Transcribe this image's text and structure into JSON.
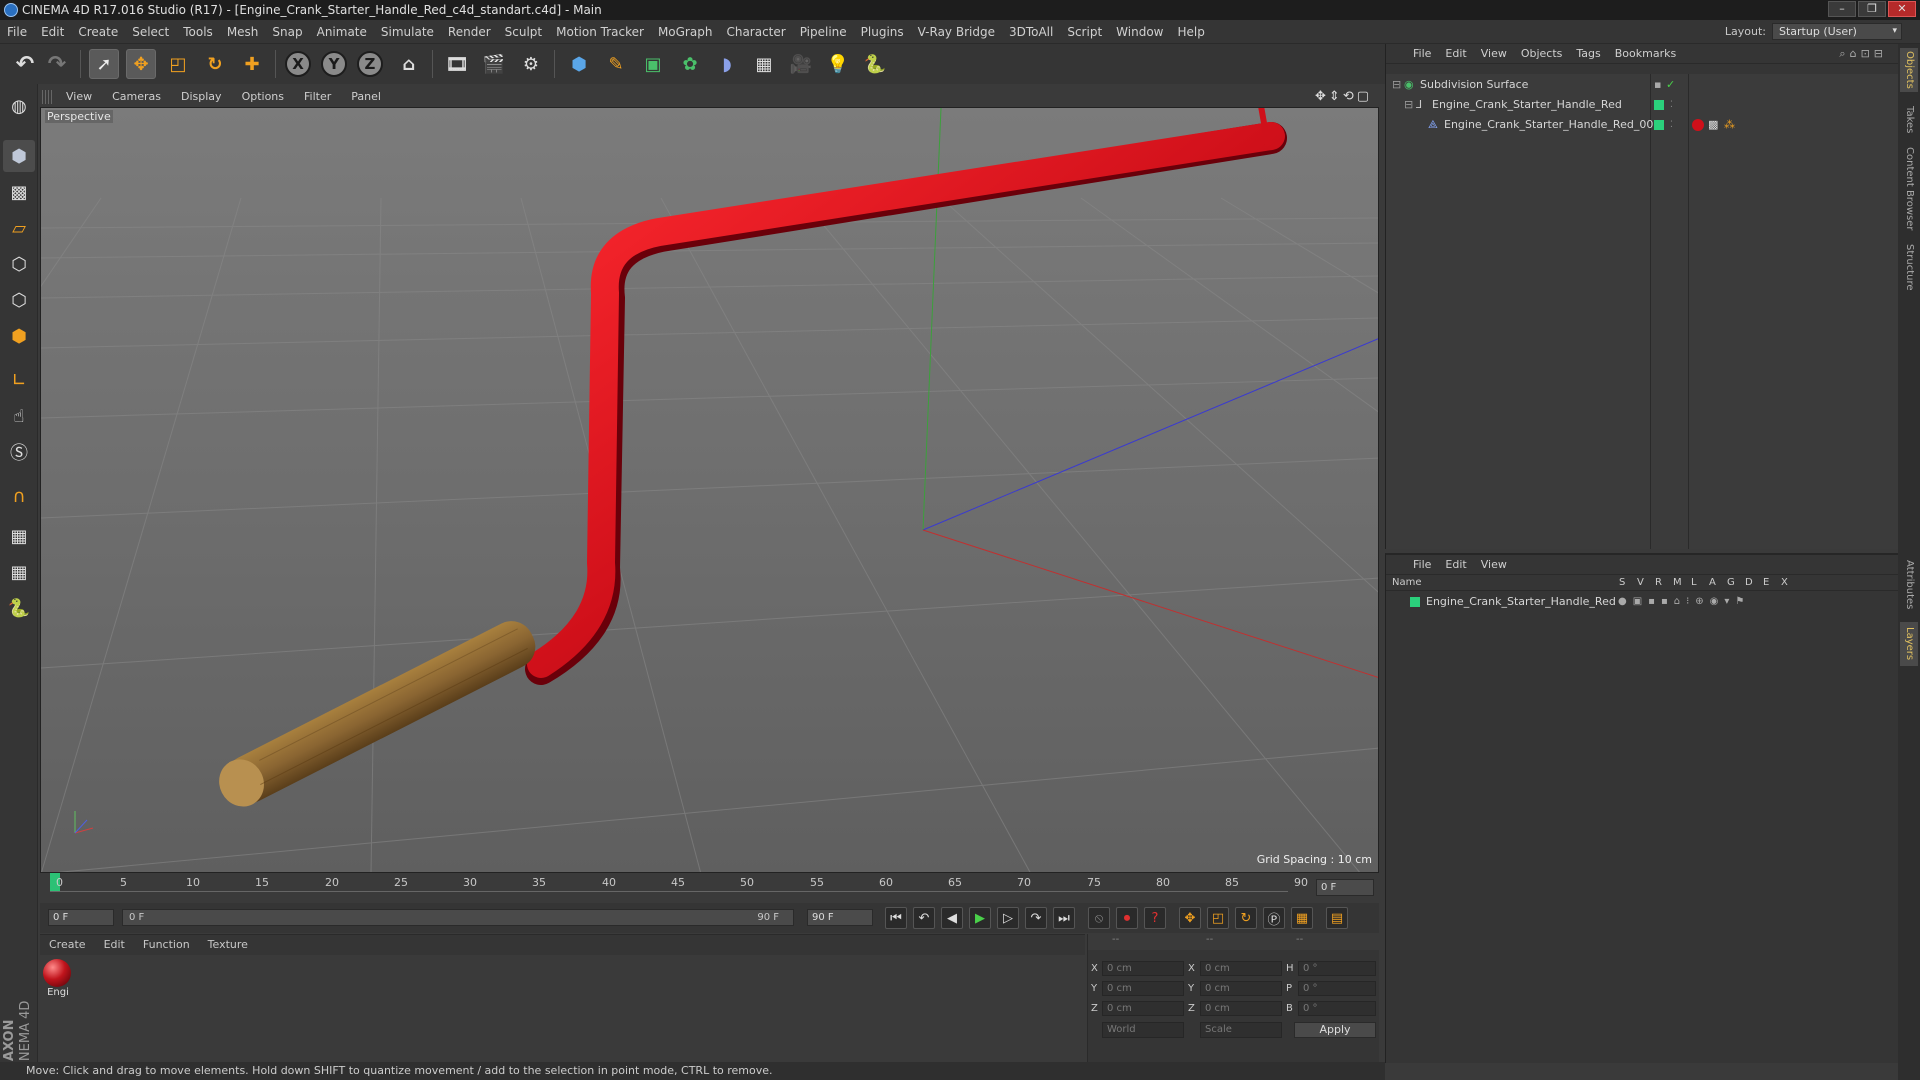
{
  "window": {
    "title": "CINEMA 4D R17.016 Studio (R17) - [Engine_Crank_Starter_Handle_Red_c4d_standart.c4d] - Main",
    "controls": [
      "–",
      "❐",
      "✕"
    ]
  },
  "menubar": {
    "items": [
      "File",
      "Edit",
      "Create",
      "Select",
      "Tools",
      "Mesh",
      "Snap",
      "Animate",
      "Simulate",
      "Render",
      "Sculpt",
      "Motion Tracker",
      "MoGraph",
      "Character",
      "Pipeline",
      "Plugins",
      "V-Ray Bridge",
      "3DToAll",
      "Script",
      "Window",
      "Help"
    ],
    "layout_label": "Layout:",
    "layout_value": "Startup (User)"
  },
  "toolbar": {
    "undo_icon": "undo-icon",
    "axis_x": "X",
    "axis_y": "Y",
    "axis_z": "Z"
  },
  "viewport": {
    "menu": [
      "View",
      "Cameras",
      "Display",
      "Options",
      "Filter",
      "Panel"
    ],
    "camera_label": "Perspective",
    "grid_spacing": "Grid Spacing : 10 cm"
  },
  "timeline": {
    "ticks": [
      "0",
      "5",
      "10",
      "15",
      "20",
      "25",
      "30",
      "35",
      "40",
      "45",
      "50",
      "55",
      "60",
      "65",
      "70",
      "75",
      "80",
      "85",
      "90"
    ],
    "current_frame": "0 F",
    "start_field": "0 F",
    "range_start": "0 F",
    "range_end": "90 F",
    "end_field": "90 F"
  },
  "materials": {
    "menu": [
      "Create",
      "Edit",
      "Function",
      "Texture"
    ],
    "items": [
      {
        "name": "Engi",
        "color": "#c0141c"
      }
    ]
  },
  "coordinates": {
    "headers": [
      "--",
      "--",
      "--"
    ],
    "rows": [
      {
        "a": "X",
        "av": "0 cm",
        "b": "X",
        "bv": "0 cm",
        "c": "H",
        "cv": "0 °"
      },
      {
        "a": "Y",
        "av": "0 cm",
        "b": "Y",
        "bv": "0 cm",
        "c": "P",
        "cv": "0 °"
      },
      {
        "a": "Z",
        "av": "0 cm",
        "b": "Z",
        "bv": "0 cm",
        "c": "B",
        "cv": "0 °"
      }
    ],
    "mode_world": "World",
    "mode_scale": "Scale",
    "apply_label": "Apply"
  },
  "object_manager": {
    "menu": [
      "File",
      "Edit",
      "View",
      "Objects",
      "Tags",
      "Bookmarks"
    ],
    "objects": [
      {
        "name": "Subdivision Surface",
        "indent": 0
      },
      {
        "name": "Engine_Crank_Starter_Handle_Red",
        "indent": 1
      },
      {
        "name": "Engine_Crank_Starter_Handle_Red_001",
        "indent": 2
      }
    ]
  },
  "layer_manager": {
    "menu": [
      "File",
      "Edit",
      "View"
    ],
    "columns": [
      "Name",
      "S",
      "V",
      "R",
      "M",
      "L",
      "A",
      "G",
      "D",
      "E",
      "X"
    ],
    "layers": [
      {
        "name": "Engine_Crank_Starter_Handle_Red",
        "color": "#2bd07c"
      }
    ]
  },
  "side_tabs": [
    "Objects",
    "Takes",
    "Content Browser",
    "Structure",
    "Attributes",
    "Layers"
  ],
  "status": {
    "text": "Move: Click and drag to move elements. Hold down SHIFT to quantize movement / add to the selection in point mode, CTRL to remove."
  },
  "brand": {
    "maxon": "MAXON",
    "product": "CINEMA 4D"
  },
  "colors": {
    "handle_red": "#d0101a",
    "grip_wood": "#8a6532",
    "layer_green": "#2bd07c",
    "accent_orange": "#f0a020"
  }
}
